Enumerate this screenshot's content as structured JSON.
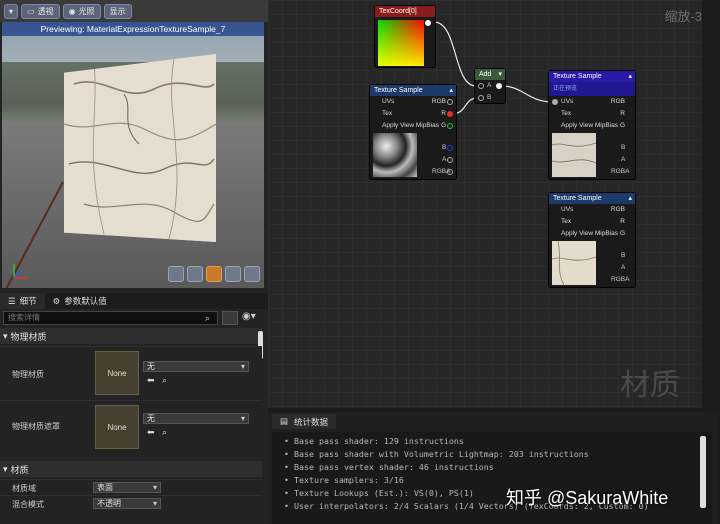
{
  "viewport": {
    "toolbar": {
      "perspective": "透视",
      "lit": "光照",
      "show": "显示"
    },
    "preview_title": "Previewing: MaterialExpressionTextureSample_7"
  },
  "details": {
    "tab_details": "细节",
    "tab_params": "参数默认值",
    "search_placeholder": "搜索详情",
    "section_physical": "物理材质",
    "phys_material_label": "物理材质",
    "phys_mask_label": "物理材质遮罩",
    "none_label": "None",
    "none_value": "无",
    "section_material": "材质",
    "domain_label": "材质域",
    "domain_value": "表面",
    "blend_label": "混合模式",
    "blend_value": "不透明"
  },
  "graph": {
    "zoom_label": "缩放-3",
    "watermark": "材质",
    "texcoord": {
      "title": "TexCoord[0]"
    },
    "add": {
      "title": "Add",
      "pin_a": "A",
      "pin_b": "B"
    },
    "tex1": {
      "title": "Texture Sample",
      "uvs": "UVs",
      "tex": "Tex",
      "mip": "Apply View MipBias",
      "rgb": "RGB",
      "r": "R",
      "g": "G",
      "b": "B",
      "a": "A",
      "rgba": "RGBA"
    },
    "tex2": {
      "title": "Texture Sample",
      "subtitle": "正在预览",
      "uvs": "UVs",
      "tex": "Tex",
      "mip": "Apply View MipBias",
      "rgb": "RGB",
      "r": "R",
      "g": "G",
      "b": "B",
      "a": "A",
      "rgba": "RGBA"
    },
    "tex3": {
      "title": "Texture Sample",
      "uvs": "UVs",
      "tex": "Tex",
      "mip": "Apply View MipBias",
      "rgb": "RGB",
      "r": "R",
      "g": "G",
      "b": "B",
      "a": "A",
      "rgba": "RGBA"
    }
  },
  "stats": {
    "tab": "统计数据",
    "lines": [
      "• Base pass shader: 129 instructions",
      "• Base pass shader with Volumetric Lightmap: 203 instructions",
      "• Base pass vertex shader: 46 instructions",
      "• Texture samplers: 3/16",
      "• Texture Lookups (Est.): VS(0), PS(1)",
      "• User interpolators: 2/4 Scalars (1/4 Vectors) (TexCoords: 2, Custom: 0)"
    ]
  },
  "credit": "知乎 @SakuraWhite"
}
